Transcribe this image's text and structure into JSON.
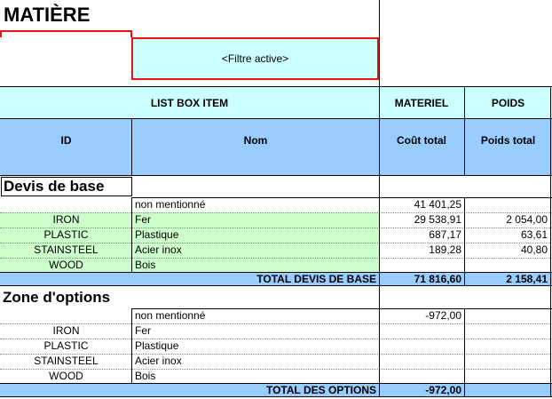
{
  "title": "MATIÈRE",
  "filter_label": "<Filtre active>",
  "header": {
    "list_box_item": "LIST BOX ITEM",
    "materiel": "MATERIEL",
    "poids": "POIDS",
    "id": "ID",
    "nom": "Nom",
    "cout_total": "Coût total",
    "poids_total": "Poids total"
  },
  "devis": {
    "title": "Devis de base",
    "rows": [
      {
        "id": "",
        "nom": "non mentionné",
        "cout": "41 401,25",
        "poids": ""
      },
      {
        "id": "IRON",
        "nom": "Fer",
        "cout": "29 538,91",
        "poids": "2 054,00"
      },
      {
        "id": "PLASTIC",
        "nom": "Plastique",
        "cout": "687,17",
        "poids": "63,61"
      },
      {
        "id": "STAINSTEEL",
        "nom": "Acier inox",
        "cout": "189,28",
        "poids": "40,80"
      },
      {
        "id": "WOOD",
        "nom": "Bois",
        "cout": "",
        "poids": ""
      }
    ],
    "total_label": "TOTAL DEVIS DE BASE",
    "total_cout": "71 816,60",
    "total_poids": "2 158,41"
  },
  "options": {
    "title": "Zone d'options",
    "rows": [
      {
        "id": "",
        "nom": "non mentionné",
        "cout": "-972,00",
        "poids": ""
      },
      {
        "id": "IRON",
        "nom": "Fer",
        "cout": "",
        "poids": ""
      },
      {
        "id": "PLASTIC",
        "nom": "Plastique",
        "cout": "",
        "poids": ""
      },
      {
        "id": "STAINSTEEL",
        "nom": "Acier inox",
        "cout": "",
        "poids": ""
      },
      {
        "id": "WOOD",
        "nom": "Bois",
        "cout": "",
        "poids": ""
      }
    ],
    "total_label": "TOTAL DES OPTIONS",
    "total_cout": "-972,00",
    "total_poids": ""
  },
  "colors": {
    "cyan": "#ccffff",
    "blue": "#99ccff",
    "green": "#ccffcc",
    "red": "#ee1111"
  }
}
